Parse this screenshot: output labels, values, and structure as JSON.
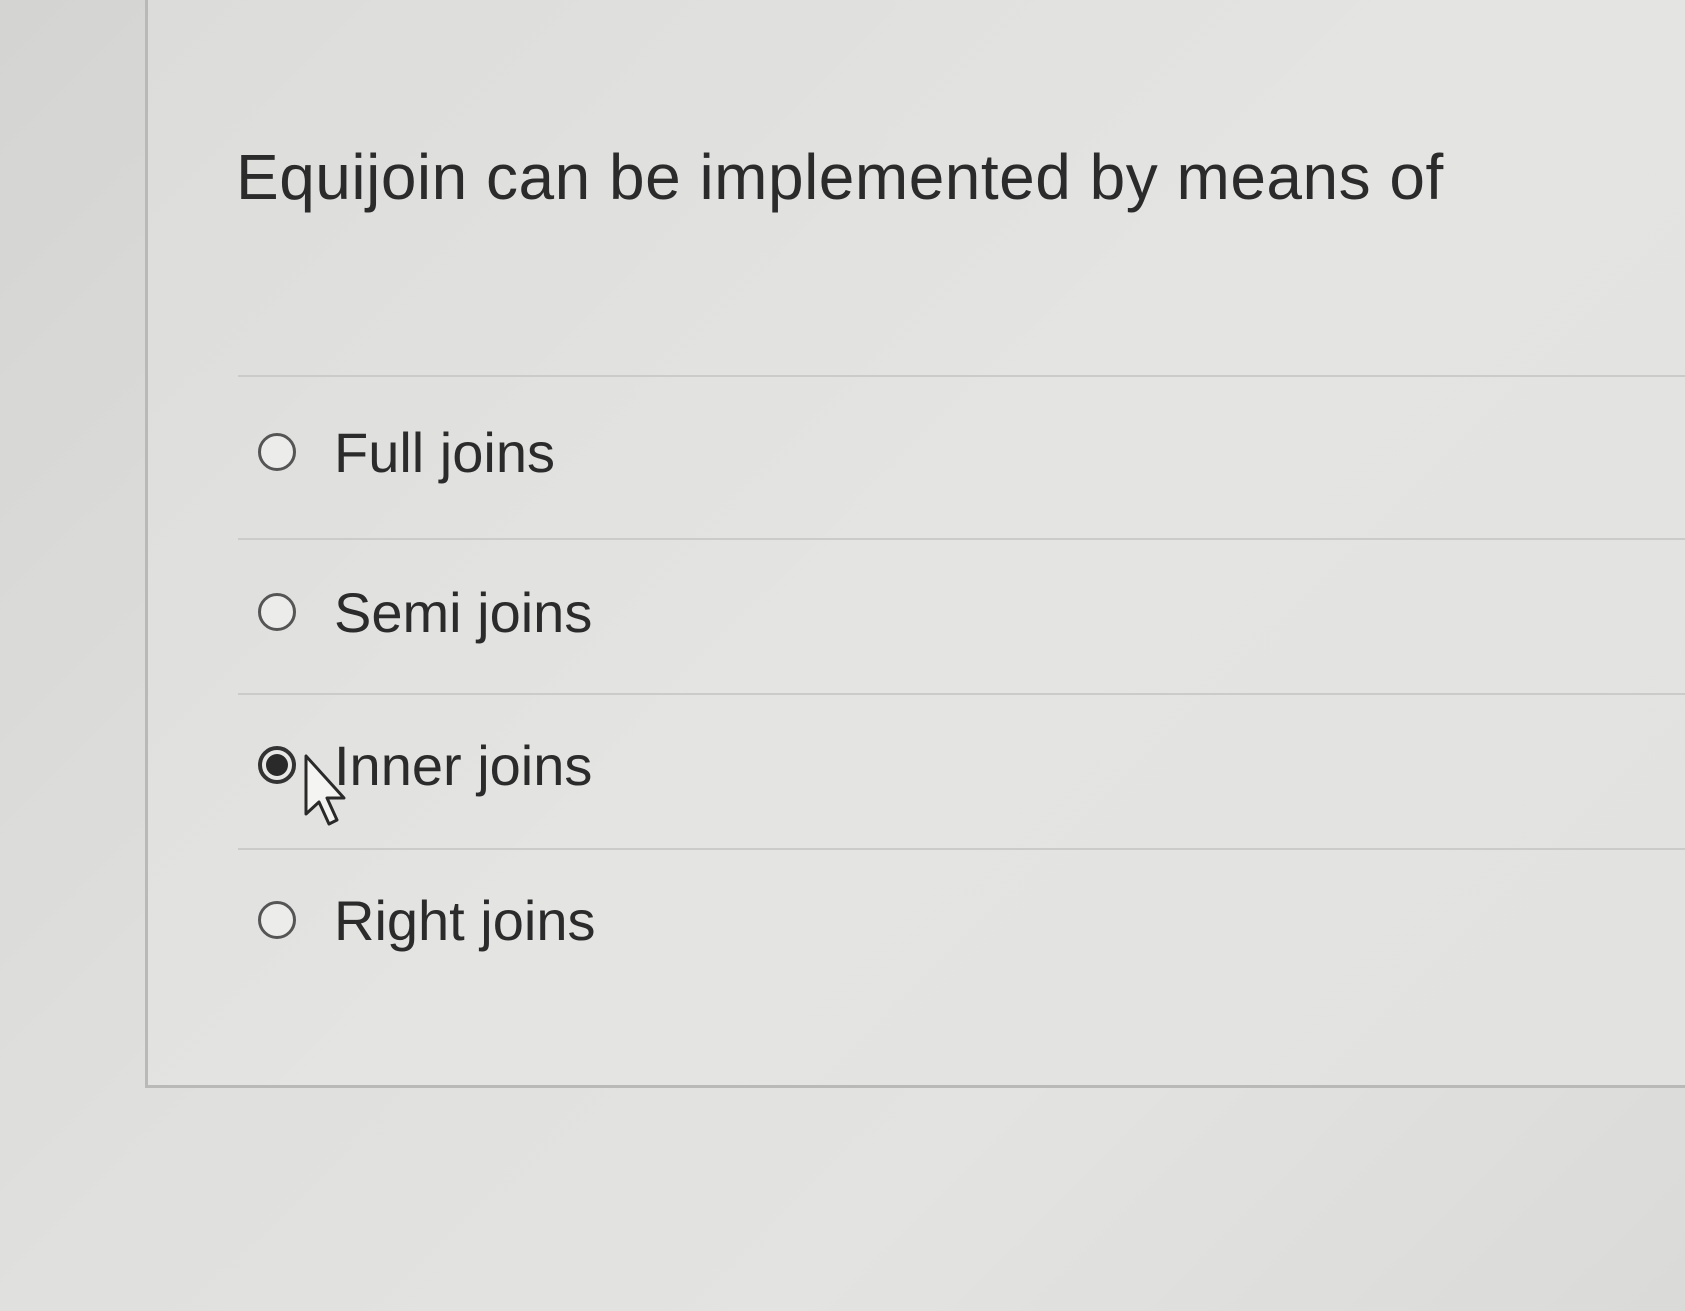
{
  "question": {
    "text": "Equijoin can be implemented by means of"
  },
  "answers": [
    {
      "label": "Full joins",
      "selected": false
    },
    {
      "label": "Semi joins",
      "selected": false
    },
    {
      "label": "Inner joins",
      "selected": true
    },
    {
      "label": "Right joins",
      "selected": false
    }
  ],
  "colors": {
    "text": "#2b2b2b",
    "background": "#e0e0de",
    "divider": "#cbcbc9"
  },
  "icons": {
    "cursor": "arrow-cursor-icon"
  }
}
